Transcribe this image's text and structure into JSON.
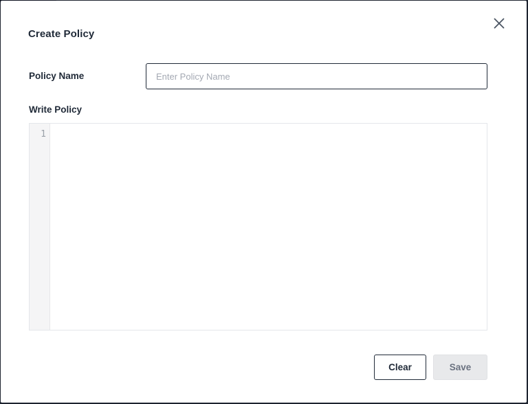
{
  "dialog": {
    "title": "Create Policy",
    "close_icon": "close-icon"
  },
  "form": {
    "policy_name_label": "Policy Name",
    "policy_name_placeholder": "Enter Policy Name",
    "policy_name_value": "",
    "write_policy_label": "Write Policy",
    "editor_line_numbers": [
      "1"
    ]
  },
  "actions": {
    "clear_label": "Clear",
    "save_label": "Save",
    "save_enabled": false
  }
}
